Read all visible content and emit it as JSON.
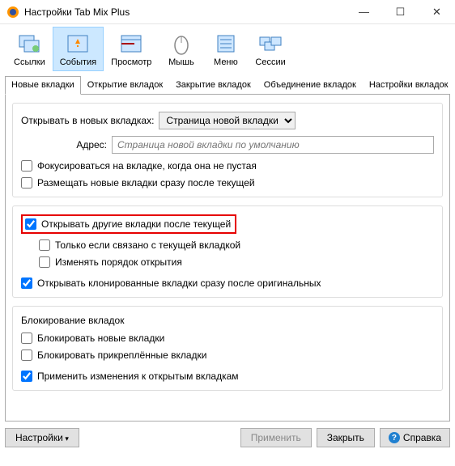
{
  "window": {
    "title": "Настройки Tab Mix Plus"
  },
  "toolbar": [
    {
      "label": "Ссылки"
    },
    {
      "label": "События"
    },
    {
      "label": "Просмотр"
    },
    {
      "label": "Мышь"
    },
    {
      "label": "Меню"
    },
    {
      "label": "Сессии"
    }
  ],
  "activeToolbar": 1,
  "tabs": [
    "Новые вкладки",
    "Открытие вкладок",
    "Закрытие вкладок",
    "Объединение вкладок",
    "Настройки вкладок"
  ],
  "activeTab": 0,
  "group1": {
    "openLabel": "Открывать в новых вкладках:",
    "openValue": "Страница новой вкладки",
    "addressLabel": "Адрес:",
    "addressPlaceholder": "Страница новой вкладки по умолчанию",
    "focus": "Фокусироваться на вкладке, когда она не пустая",
    "placeAfter": "Размещать новые вкладки сразу после текущей"
  },
  "group2": {
    "openOther": "Открывать другие вкладки после текущей",
    "onlyRelated": "Только если связано с текущей вкладкой",
    "changeOrder": "Изменять порядок открытия",
    "openCloned": "Открывать клонированные вкладки сразу после оригинальных"
  },
  "group3": {
    "heading": "Блокирование вкладок",
    "blockNew": "Блокировать новые вкладки",
    "blockPinned": "Блокировать прикреплённые вкладки",
    "applyOpen": "Применить изменения к открытым вкладкам"
  },
  "footer": {
    "settings": "Настройки",
    "apply": "Применить",
    "close": "Закрыть",
    "help": "Справка"
  }
}
